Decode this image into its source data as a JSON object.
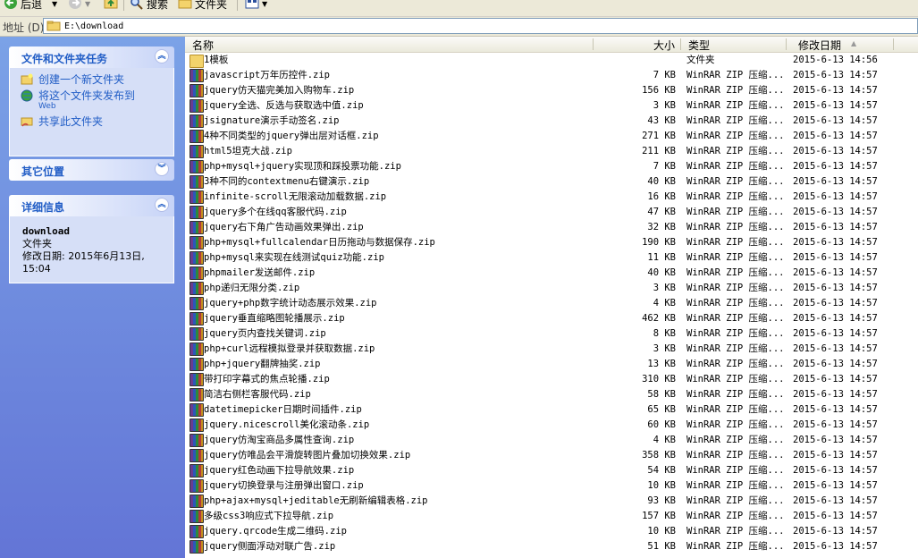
{
  "toolbar": {
    "back_label": "后退",
    "search_label": "搜索",
    "folders_label": "文件夹"
  },
  "address": {
    "label": "地址 (D)",
    "value": "E:\\download"
  },
  "left": {
    "tasks_panel": {
      "title": "文件和文件夹任务",
      "items": [
        {
          "label": "创建一个新文件夹"
        },
        {
          "label": "将这个文件夹发布到",
          "sub": "Web"
        },
        {
          "label": "共享此文件夹"
        }
      ]
    },
    "other_places": {
      "title": "其它位置"
    },
    "details": {
      "title": "详细信息",
      "name": "download",
      "type": "文件夹",
      "modified_line1": "修改日期: 2015年6月13日,",
      "modified_line2": "15:04"
    }
  },
  "columns": {
    "name": "名称",
    "size": "大小",
    "type": "类型",
    "date": "修改日期"
  },
  "files": [
    {
      "name": "1模板",
      "size": "",
      "type": "文件夹",
      "date": "2015-6-13 14:56",
      "kind": "folder"
    },
    {
      "name": "javascript万年历控件.zip",
      "size": "7 KB",
      "type": "WinRAR ZIP 压缩...",
      "date": "2015-6-13 14:57",
      "kind": "zip"
    },
    {
      "name": "jquery仿天猫完美加入购物车.zip",
      "size": "156 KB",
      "type": "WinRAR ZIP 压缩...",
      "date": "2015-6-13 14:57",
      "kind": "zip"
    },
    {
      "name": "jquery全选、反选与获取选中值.zip",
      "size": "3 KB",
      "type": "WinRAR ZIP 压缩...",
      "date": "2015-6-13 14:57",
      "kind": "zip"
    },
    {
      "name": "jsignature演示手动签名.zip",
      "size": "43 KB",
      "type": "WinRAR ZIP 压缩...",
      "date": "2015-6-13 14:57",
      "kind": "zip"
    },
    {
      "name": "4种不同类型的jquery弹出层对话框.zip",
      "size": "271 KB",
      "type": "WinRAR ZIP 压缩...",
      "date": "2015-6-13 14:57",
      "kind": "zip"
    },
    {
      "name": "html5坦克大战.zip",
      "size": "211 KB",
      "type": "WinRAR ZIP 压缩...",
      "date": "2015-6-13 14:57",
      "kind": "zip"
    },
    {
      "name": "php+mysql+jquery实现顶和踩投票功能.zip",
      "size": "7 KB",
      "type": "WinRAR ZIP 压缩...",
      "date": "2015-6-13 14:57",
      "kind": "zip"
    },
    {
      "name": "3种不同的contextmenu右键演示.zip",
      "size": "40 KB",
      "type": "WinRAR ZIP 压缩...",
      "date": "2015-6-13 14:57",
      "kind": "zip"
    },
    {
      "name": "infinite-scroll无限滚动加载数据.zip",
      "size": "16 KB",
      "type": "WinRAR ZIP 压缩...",
      "date": "2015-6-13 14:57",
      "kind": "zip"
    },
    {
      "name": "jquery多个在线qq客服代码.zip",
      "size": "47 KB",
      "type": "WinRAR ZIP 压缩...",
      "date": "2015-6-13 14:57",
      "kind": "zip"
    },
    {
      "name": "jquery右下角广告动画效果弹出.zip",
      "size": "32 KB",
      "type": "WinRAR ZIP 压缩...",
      "date": "2015-6-13 14:57",
      "kind": "zip"
    },
    {
      "name": "php+mysql+fullcalendar日历拖动与数据保存.zip",
      "size": "190 KB",
      "type": "WinRAR ZIP 压缩...",
      "date": "2015-6-13 14:57",
      "kind": "zip"
    },
    {
      "name": "php+mysql来实现在线测试quiz功能.zip",
      "size": "11 KB",
      "type": "WinRAR ZIP 压缩...",
      "date": "2015-6-13 14:57",
      "kind": "zip"
    },
    {
      "name": "phpmailer发送邮件.zip",
      "size": "40 KB",
      "type": "WinRAR ZIP 压缩...",
      "date": "2015-6-13 14:57",
      "kind": "zip"
    },
    {
      "name": "php递归无限分类.zip",
      "size": "3 KB",
      "type": "WinRAR ZIP 压缩...",
      "date": "2015-6-13 14:57",
      "kind": "zip"
    },
    {
      "name": "jquery+php数字统计动态展示效果.zip",
      "size": "4 KB",
      "type": "WinRAR ZIP 压缩...",
      "date": "2015-6-13 14:57",
      "kind": "zip"
    },
    {
      "name": "jquery垂直缩略图轮播展示.zip",
      "size": "462 KB",
      "type": "WinRAR ZIP 压缩...",
      "date": "2015-6-13 14:57",
      "kind": "zip"
    },
    {
      "name": "jquery页内查找关键词.zip",
      "size": "8 KB",
      "type": "WinRAR ZIP 压缩...",
      "date": "2015-6-13 14:57",
      "kind": "zip"
    },
    {
      "name": "php+curl远程模拟登录并获取数据.zip",
      "size": "3 KB",
      "type": "WinRAR ZIP 压缩...",
      "date": "2015-6-13 14:57",
      "kind": "zip"
    },
    {
      "name": "php+jquery翻牌抽奖.zip",
      "size": "13 KB",
      "type": "WinRAR ZIP 压缩...",
      "date": "2015-6-13 14:57",
      "kind": "zip"
    },
    {
      "name": "带打印字幕式的焦点轮播.zip",
      "size": "310 KB",
      "type": "WinRAR ZIP 压缩...",
      "date": "2015-6-13 14:57",
      "kind": "zip"
    },
    {
      "name": "简洁右侧栏客服代码.zip",
      "size": "58 KB",
      "type": "WinRAR ZIP 压缩...",
      "date": "2015-6-13 14:57",
      "kind": "zip"
    },
    {
      "name": "datetimepicker日期时间插件.zip",
      "size": "65 KB",
      "type": "WinRAR ZIP 压缩...",
      "date": "2015-6-13 14:57",
      "kind": "zip"
    },
    {
      "name": "jquery.nicescroll美化滚动条.zip",
      "size": "60 KB",
      "type": "WinRAR ZIP 压缩...",
      "date": "2015-6-13 14:57",
      "kind": "zip"
    },
    {
      "name": "jquery仿淘宝商品多属性查询.zip",
      "size": "4 KB",
      "type": "WinRAR ZIP 压缩...",
      "date": "2015-6-13 14:57",
      "kind": "zip"
    },
    {
      "name": "jquery仿唯品会平滑旋转图片叠加切换效果.zip",
      "size": "358 KB",
      "type": "WinRAR ZIP 压缩...",
      "date": "2015-6-13 14:57",
      "kind": "zip"
    },
    {
      "name": "jquery红色动画下拉导航效果.zip",
      "size": "54 KB",
      "type": "WinRAR ZIP 压缩...",
      "date": "2015-6-13 14:57",
      "kind": "zip"
    },
    {
      "name": "jquery切换登录与注册弹出窗口.zip",
      "size": "10 KB",
      "type": "WinRAR ZIP 压缩...",
      "date": "2015-6-13 14:57",
      "kind": "zip"
    },
    {
      "name": "php+ajax+mysql+jeditable无刷新编辑表格.zip",
      "size": "93 KB",
      "type": "WinRAR ZIP 压缩...",
      "date": "2015-6-13 14:57",
      "kind": "zip"
    },
    {
      "name": "多级css3响应式下拉导航.zip",
      "size": "157 KB",
      "type": "WinRAR ZIP 压缩...",
      "date": "2015-6-13 14:57",
      "kind": "zip"
    },
    {
      "name": "jquery.qrcode生成二维码.zip",
      "size": "10 KB",
      "type": "WinRAR ZIP 压缩...",
      "date": "2015-6-13 14:57",
      "kind": "zip"
    },
    {
      "name": "jquery侧面浮动对联广告.zip",
      "size": "51 KB",
      "type": "WinRAR ZIP 压缩...",
      "date": "2015-6-13 14:57",
      "kind": "zip"
    }
  ]
}
